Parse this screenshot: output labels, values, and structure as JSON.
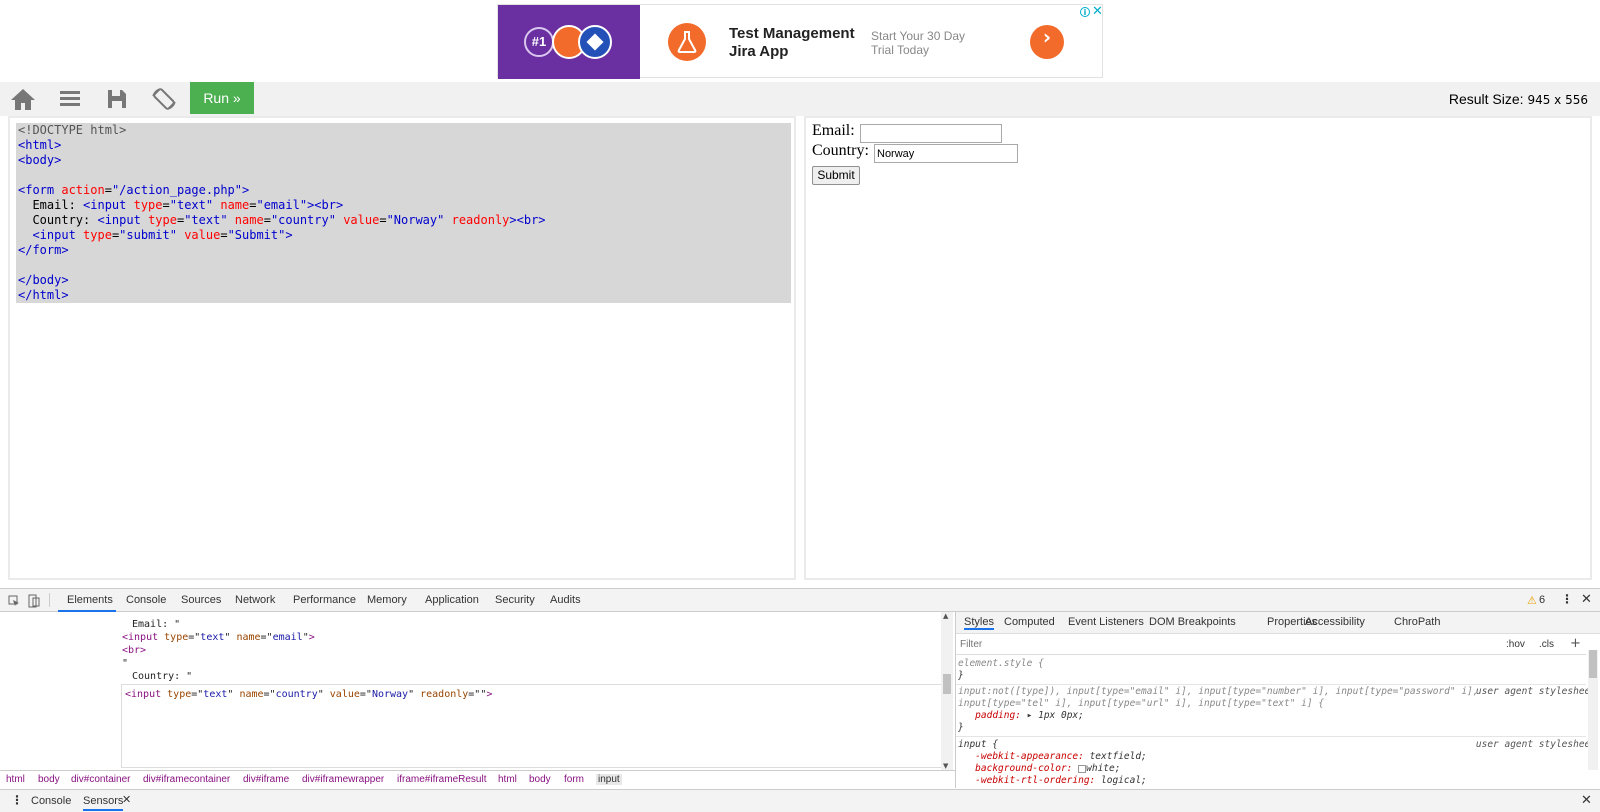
{
  "ad": {
    "badge": "#1",
    "title": "Test Management Jira App",
    "subtitle": "Start Your 30 Day Trial Today"
  },
  "toolbar": {
    "run_label": "Run »",
    "result_size_label": "Result Size:",
    "result_size_value": "945 x 556"
  },
  "code_lines": [
    "<!DOCTYPE html>",
    "<html>",
    "<body>",
    "",
    "<form action=\"/action_page.php\">",
    "  Email: <input type=\"text\" name=\"email\"><br>",
    "  Country: <input type=\"text\" name=\"country\" value=\"Norway\" readonly><br>",
    "  <input type=\"submit\" value=\"Submit\">",
    "</form>",
    "",
    "</body>",
    "</html>"
  ],
  "result": {
    "email_label": "Email:",
    "email_value": "",
    "country_label": "Country:",
    "country_value": "Norway",
    "submit_label": "Submit"
  },
  "devtools": {
    "tabs": [
      "Elements",
      "Console",
      "Sources",
      "Network",
      "Performance",
      "Memory",
      "Application",
      "Security",
      "Audits"
    ],
    "warnings": "6",
    "dom_lines": [
      "Email: \"",
      "<input type=\"text\" name=\"email\">",
      "<br>",
      "\"",
      "Country: \"",
      "<input type=\"text\" name=\"country\" value=\"Norway\" readonly=\"\">"
    ],
    "breadcrumb": [
      "html",
      "body",
      "div#container",
      "div#iframecontainer",
      "div#iframe",
      "div#iframewrapper",
      "iframe#iframeResult",
      "html",
      "body",
      "form",
      "input"
    ],
    "styles_tabs": [
      "Styles",
      "Computed",
      "Event Listeners",
      "DOM Breakpoints",
      "Properties",
      "Accessibility",
      "ChroPath"
    ],
    "filter_placeholder": "Filter",
    "hov": ":hov",
    ".cls": ".cls",
    "rules": {
      "element_style": "element.style {",
      "close": "}",
      "r1_sel": "input:not([type]), input[type=\"email\" i], input[type=\"number\" i], input[type=\"password\" i],",
      "r1_sel2": "input[type=\"tel\" i], input[type=\"url\" i], input[type=\"text\" i] {",
      "r1_src": "user agent stylesheet",
      "r1_prop": "padding:",
      "r1_val": "▸ 1px 0px;",
      "r2_sel": "input {",
      "r2_src": "user agent stylesheet",
      "r2_p1": "-webkit-appearance:",
      "r2_v1": "textfield;",
      "r2_p2": "background-color:",
      "r2_v2": "white;",
      "r2_p3": "-webkit-rtl-ordering:",
      "r2_v3": "logical;"
    },
    "drawer_tabs": [
      "Console",
      "Sensors"
    ]
  }
}
